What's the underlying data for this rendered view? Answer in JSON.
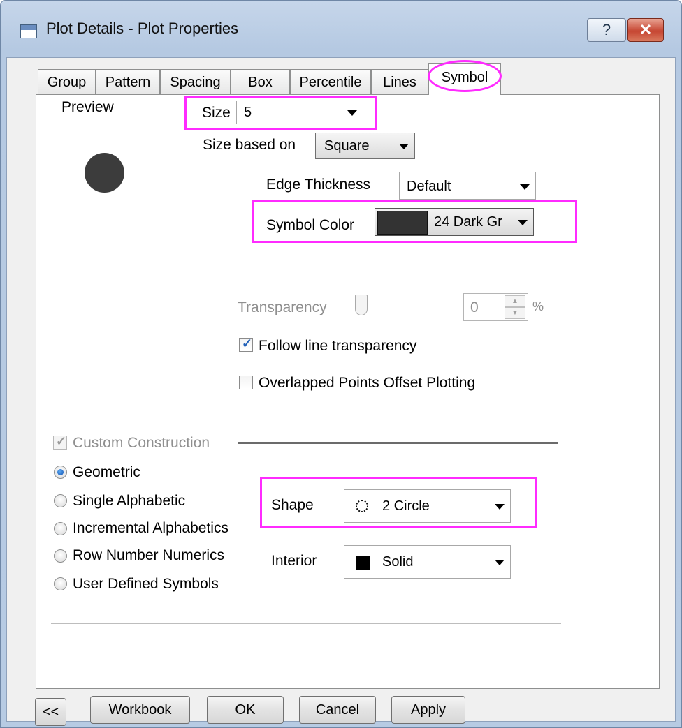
{
  "window": {
    "title": "Plot Details - Plot Properties",
    "help_glyph": "?",
    "close_glyph": "✕"
  },
  "tabs": [
    {
      "label": "Group"
    },
    {
      "label": "Pattern"
    },
    {
      "label": "Spacing"
    },
    {
      "label": "Box"
    },
    {
      "label": "Percentile"
    },
    {
      "label": "Lines"
    },
    {
      "label": "Symbol",
      "active": true
    }
  ],
  "preview": {
    "label": "Preview"
  },
  "size": {
    "label": "Size",
    "value": "5"
  },
  "size_based_on": {
    "label": "Size based on",
    "value": "Square"
  },
  "edge_thickness": {
    "label": "Edge Thickness",
    "value": "Default"
  },
  "symbol_color": {
    "label": "Symbol Color",
    "value": "24 Dark Gr",
    "swatch_color": "#333333"
  },
  "transparency": {
    "label": "Transparency",
    "value": "0",
    "unit": "%",
    "slider_fraction": 0
  },
  "follow_line_transparency": {
    "label": "Follow line transparency",
    "checked": true
  },
  "overlapped_points": {
    "label": "Overlapped Points Offset Plotting",
    "checked": false
  },
  "custom_construction": {
    "label": "Custom Construction",
    "checked": true,
    "enabled": false
  },
  "construction_options": [
    {
      "label": "Geometric",
      "selected": true
    },
    {
      "label": "Single Alphabetic",
      "selected": false
    },
    {
      "label": "Incremental Alphabetics",
      "selected": false
    },
    {
      "label": "Row Number Numerics",
      "selected": false
    },
    {
      "label": "User Defined Symbols",
      "selected": false
    }
  ],
  "shape": {
    "label": "Shape",
    "value": "2 Circle"
  },
  "interior": {
    "label": "Interior",
    "value": "Solid"
  },
  "buttons": {
    "collapse": "<<",
    "workbook": "Workbook",
    "ok": "OK",
    "cancel": "Cancel",
    "apply": "Apply"
  },
  "colors": {
    "highlight": "#ff2bff",
    "preview_symbol": "#3c3c3c",
    "check_accent": "#1f5fb8"
  }
}
